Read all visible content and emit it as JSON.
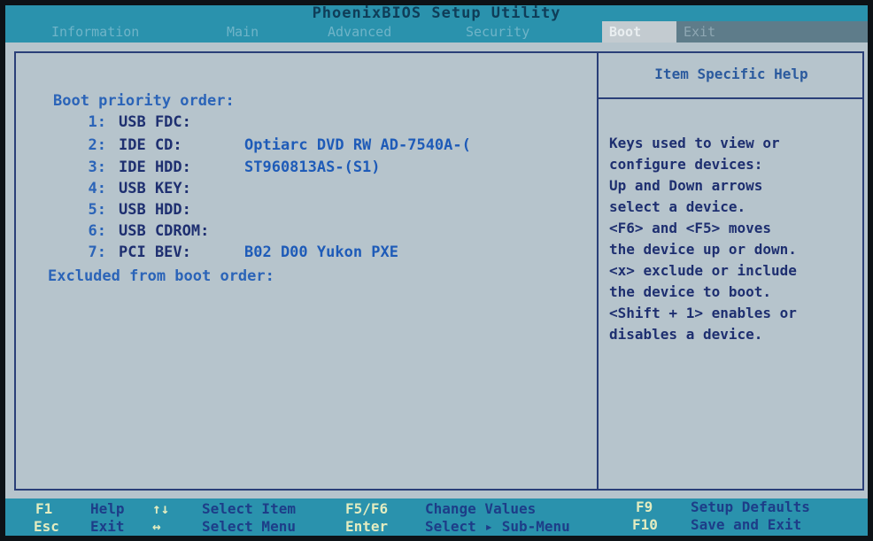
{
  "title": "PhoenixBIOS Setup Utility",
  "tabs": [
    {
      "label": "Information"
    },
    {
      "label": "Main"
    },
    {
      "label": "Advanced"
    },
    {
      "label": "Security"
    },
    {
      "label": "Boot"
    },
    {
      "label": "Exit"
    }
  ],
  "active_tab": "Boot",
  "main": {
    "boot_priority_heading": "Boot priority order:",
    "boot_items": [
      {
        "num": "1:",
        "type": "USB FDC:",
        "device": ""
      },
      {
        "num": "2:",
        "type": "IDE CD:",
        "device": "Optiarc DVD RW AD-7540A-("
      },
      {
        "num": "3:",
        "type": "IDE HDD:",
        "device": "ST960813AS-(S1)"
      },
      {
        "num": "4:",
        "type": "USB KEY:",
        "device": ""
      },
      {
        "num": "5:",
        "type": "USB HDD:",
        "device": ""
      },
      {
        "num": "6:",
        "type": "USB CDROM:",
        "device": ""
      },
      {
        "num": "7:",
        "type": "PCI BEV:",
        "device": "B02 D00 Yukon PXE"
      }
    ],
    "excluded_heading": "Excluded from boot order:"
  },
  "help": {
    "title": "Item Specific Help",
    "lines": [
      "Keys used to view or",
      "configure devices:",
      "Up and Down arrows",
      "select a device.",
      "<F6> and <F5> moves",
      "the device up or down.",
      "<x> exclude or include",
      "the device to boot.",
      "<Shift + 1> enables or",
      "disables a device."
    ]
  },
  "footer": {
    "f1_key": "F1",
    "f1_desc": "Help",
    "updown_icon": "↑↓",
    "updown_desc": "Select Item",
    "f5f6_key": "F5/F6",
    "f5f6_desc": "Change Values",
    "f9_key": "F9",
    "f9_desc": "Setup Defaults",
    "esc_key": "Esc",
    "esc_desc": "Exit",
    "leftright_icon": "↔",
    "leftright_desc": "Select Menu",
    "enter_key": "Enter",
    "enter_desc": "Select ▸ Sub-Menu",
    "f10_key": "F10",
    "f10_desc": "Save and Exit"
  },
  "colors": {
    "background": "#b6c4cc",
    "bar": "#2a92ad",
    "text_dark": "#1e2f70",
    "text_blue": "#2b64b8",
    "key_yellow": "#e3ecc0"
  }
}
